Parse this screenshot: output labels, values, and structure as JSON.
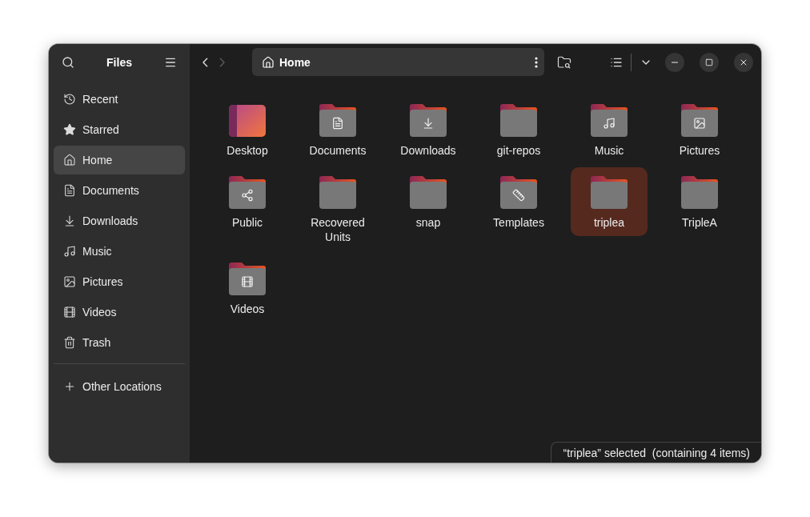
{
  "sidebar": {
    "title": "Files",
    "items": [
      {
        "label": "Recent",
        "kind": "recent",
        "selected": false
      },
      {
        "label": "Starred",
        "kind": "starred",
        "selected": false
      },
      {
        "label": "Home",
        "kind": "home",
        "selected": true
      },
      {
        "label": "Documents",
        "kind": "documents",
        "selected": false
      },
      {
        "label": "Downloads",
        "kind": "downloads",
        "selected": false
      },
      {
        "label": "Music",
        "kind": "music",
        "selected": false
      },
      {
        "label": "Pictures",
        "kind": "pictures",
        "selected": false
      },
      {
        "label": "Videos",
        "kind": "videos",
        "selected": false
      },
      {
        "label": "Trash",
        "kind": "trash",
        "selected": false
      }
    ],
    "other_locations": "Other Locations"
  },
  "toolbar": {
    "forward_disabled": true,
    "path": "Home"
  },
  "files": [
    {
      "name": "Desktop",
      "kind": "desktop",
      "selected": false
    },
    {
      "name": "Documents",
      "kind": "documents",
      "selected": false
    },
    {
      "name": "Downloads",
      "kind": "downloads",
      "selected": false
    },
    {
      "name": "git-repos",
      "kind": "plain",
      "selected": false
    },
    {
      "name": "Music",
      "kind": "music",
      "selected": false
    },
    {
      "name": "Pictures",
      "kind": "pictures",
      "selected": false
    },
    {
      "name": "Public",
      "kind": "public",
      "selected": false
    },
    {
      "name": "Recovered Units",
      "kind": "plain",
      "selected": false
    },
    {
      "name": "snap",
      "kind": "plain",
      "selected": false
    },
    {
      "name": "Templates",
      "kind": "templates",
      "selected": false
    },
    {
      "name": "triplea",
      "kind": "plain",
      "selected": true
    },
    {
      "name": "TripleA",
      "kind": "plain",
      "selected": false
    },
    {
      "name": "Videos",
      "kind": "videos",
      "selected": false
    }
  ],
  "status": "“triplea” selected  (containing 4 items)"
}
